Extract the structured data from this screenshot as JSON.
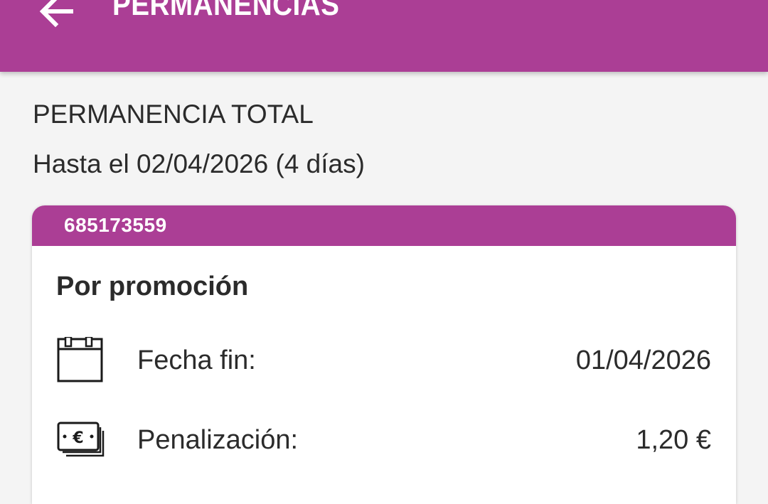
{
  "app_bar": {
    "title": "PERMANENCIAS",
    "back_icon": "arrow-left-icon",
    "color": "#ab3e95"
  },
  "summary": {
    "title": "PERMANENCIA TOTAL",
    "subtitle": "Hasta el 02/04/2026 (4 días)"
  },
  "card": {
    "line_number": "685173559",
    "promo_title": "Por promoción",
    "rows": [
      {
        "icon": "calendar-icon",
        "label": "Fecha fin:",
        "value": "01/04/2026"
      },
      {
        "icon": "money-euro-icon",
        "label": "Penalización:",
        "value": "1,20 €"
      }
    ]
  }
}
